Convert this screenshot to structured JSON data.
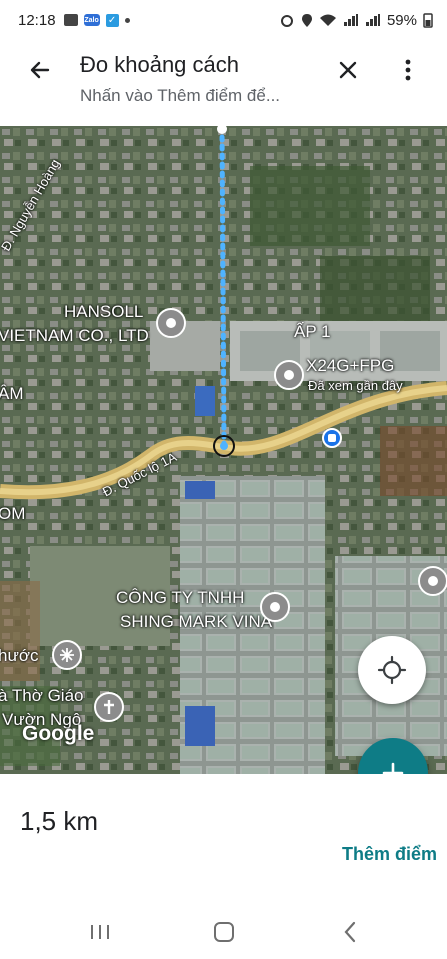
{
  "status_bar": {
    "time": "12:18",
    "battery": "59%"
  },
  "app_bar": {
    "title": "Đo khoảng cách",
    "subtitle": "Nhấn vào Thêm điểm để..."
  },
  "map": {
    "labels": {
      "nguyen_hoang": "Đ. Nguyễn Hoàng",
      "hansoll_1": "HANSOLL",
      "hansoll_2": "VIETNAM CO., LTD",
      "ap1": "ẤP 1",
      "x24g": "X24G+FPG",
      "recent": "Đã xem gần đây",
      "quoc_lo": "Đ. Quốc lộ 1A",
      "am": "ÂM",
      "om": "OM",
      "cty_1": "CÔNG TY TNHH",
      "cty_2": "SHING MARK VINA",
      "phuoc": "hước",
      "tho_giao": "à Thờ Giáo",
      "vuon_ngo": "Vườn Ngô"
    },
    "logo": "Google"
  },
  "measurement": {
    "distance": "1,5 km",
    "add_point": "Thêm điểm"
  },
  "icons": {
    "back": "back-arrow-icon",
    "close": "close-icon",
    "more": "more-vert-icon",
    "locate": "my-location-icon",
    "add": "plus-icon",
    "recents": "recents-icon",
    "home": "home-icon",
    "nav_back": "nav-back-icon"
  },
  "colors": {
    "accent": "#0e7c86",
    "route": "#4fb3ff"
  }
}
